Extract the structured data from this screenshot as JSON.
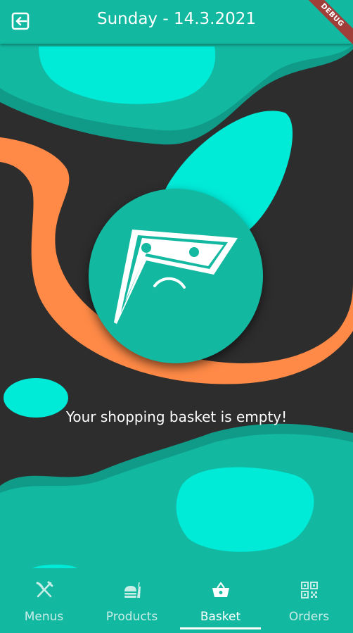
{
  "appbar": {
    "title": "Sunday - 14.3.2021",
    "debug_banner": "DEBUG"
  },
  "empty_state": {
    "message": "Your shopping basket is empty!"
  },
  "nav": {
    "items": [
      {
        "label": "Menus",
        "icon": "fork-knife-icon"
      },
      {
        "label": "Products",
        "icon": "food-burger-icon"
      },
      {
        "label": "Basket",
        "icon": "basket-icon"
      },
      {
        "label": "Orders",
        "icon": "qr-code-icon"
      }
    ],
    "active": "Basket"
  },
  "colors": {
    "primary": "#12b8a0",
    "accent_cyan": "#00ead8",
    "orange": "#ff8a47",
    "dark": "#2d2d2d"
  }
}
